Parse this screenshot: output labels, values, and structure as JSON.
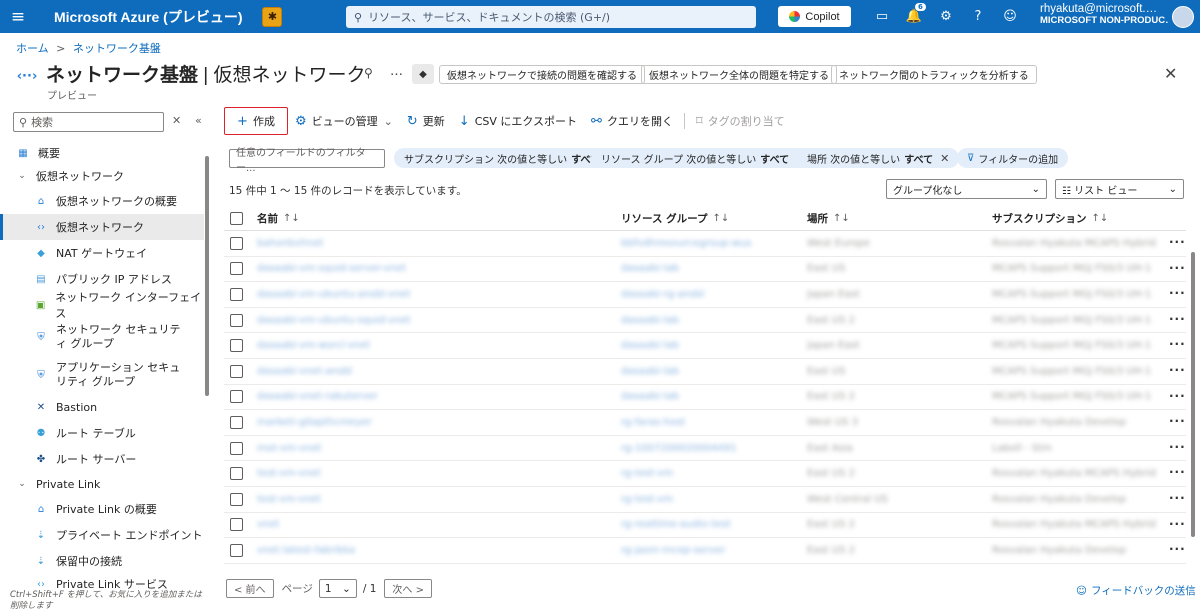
{
  "topbar": {
    "brand": "Microsoft Azure (プレビュー)",
    "search_placeholder": "リソース、サービス、ドキュメントの検索 (G+/)",
    "copilot_label": "Copilot",
    "notification_count": "6",
    "user_email": "rhyakuta@microsoft.…",
    "user_tenant": "MICROSOFT NON-PRODUC…",
    "colors": {
      "bar": "#0f6cbd"
    }
  },
  "breadcrumb": [
    "ホーム",
    ">",
    "ネットワーク基盤"
  ],
  "page": {
    "title_main": "ネットワーク基盤",
    "title_sep": "|",
    "title_sub": "仮想ネットワーク",
    "subtitle": "プレビュー",
    "more": "…",
    "header_buttons": [
      "仮想ネットワークで接続の問題を確認する",
      "仮想ネットワーク全体の問題を特定する",
      "ネットワーク間のトラフィックを分析する"
    ]
  },
  "sidebar": {
    "search_placeholder": "検索",
    "items": [
      {
        "label": "概要",
        "icon": "overview-icon",
        "level": 0
      },
      {
        "label": "仮想ネットワーク",
        "icon": "chevron-down-icon",
        "level": 0,
        "group": true
      },
      {
        "label": "仮想ネットワークの概要",
        "icon": "home-icon",
        "level": 1
      },
      {
        "label": "仮想ネットワーク",
        "icon": "vnet-icon",
        "level": 1,
        "selected": true
      },
      {
        "label": "NAT ゲートウェイ",
        "icon": "nat-gateway-icon",
        "level": 1
      },
      {
        "label": "パブリック IP アドレス",
        "icon": "public-ip-icon",
        "level": 1
      },
      {
        "label": "ネットワーク インターフェイス",
        "icon": "nic-icon",
        "level": 1
      },
      {
        "label": "ネットワーク セキュリティ グループ",
        "icon": "nsg-icon",
        "level": 1,
        "multiline": true
      },
      {
        "label": "アプリケーション セキュリティ グループ",
        "icon": "asg-icon",
        "level": 1,
        "multiline": true
      },
      {
        "label": "Bastion",
        "icon": "bastion-icon",
        "level": 1
      },
      {
        "label": "ルート テーブル",
        "icon": "route-table-icon",
        "level": 1
      },
      {
        "label": "ルート サーバー",
        "icon": "route-server-icon",
        "level": 1
      },
      {
        "label": "Private Link",
        "icon": "chevron-down-icon",
        "level": 0,
        "group": true
      },
      {
        "label": "Private Link の概要",
        "icon": "private-link-icon",
        "level": 1
      },
      {
        "label": "プライベート エンドポイント",
        "icon": "private-endpoint-icon",
        "level": 1
      },
      {
        "label": "保留中の接続",
        "icon": "pending-connection-icon",
        "level": 1
      },
      {
        "label": "Private Link サービス",
        "icon": "private-link-service-icon",
        "level": 1
      }
    ],
    "footer": "Ctrl+Shift+F を押して、お気に入りを追加または削除します"
  },
  "toolbar": {
    "create": "作成",
    "manage_view": "ビューの管理",
    "refresh": "更新",
    "export_csv": "CSV にエクスポート",
    "open_query": "クエリを開く",
    "assign_tags": "タグの割り当て"
  },
  "filters": {
    "placeholder": "任意のフィールドのフィルター...",
    "pills": [
      {
        "text": "サブスクリプション 次の値と等しい",
        "value": "すべて",
        "removable": false
      },
      {
        "text": "リソース グループ 次の値と等しい",
        "value": "すべて",
        "removable": true
      },
      {
        "text": "場所 次の値と等しい",
        "value": "すべて",
        "removable": true
      }
    ],
    "add_filter": "フィルターの追加"
  },
  "records_text": "15 件中 1 ～ 15 件のレコードを表示しています。",
  "grouping": "グループ化なし",
  "view_mode": "リスト ビュー",
  "table": {
    "columns": [
      "名前",
      "リソース グループ",
      "場所",
      "サブスクリプション"
    ],
    "rows": [
      [
        "bahonbvhnet",
        "bbfvdhresourcegroup-wus",
        "West Europe",
        "Rosvalan Hyakuta MCAPS Hybrid"
      ],
      [
        "dasaabi-vm-squid-server-vnet",
        "dasaabi-lab",
        "East US",
        "MCAPS Support MGJ FS0/3 UH-1"
      ],
      [
        "dasaabi-vm-ubuntu-ansbl-vnet",
        "dasaabi-rg-ansbl",
        "Japan East",
        "MCAPS Support MGJ FS0/3 UH-1"
      ],
      [
        "dasaabi-vm-ubuntu-squid-vnet",
        "dasaabi-lab",
        "East US 2",
        "MCAPS Support MGJ FS0/3 UH-1"
      ],
      [
        "dasaabi-vm-wsrcl-vnet",
        "dasaabi-lab",
        "Japan East",
        "MCAPS Support MGJ FS0/3 UH-1"
      ],
      [
        "dasaabi-vnet-ansbl",
        "dasaabi-lab",
        "East US",
        "MCAPS Support MGJ FS0/3 UH-1"
      ],
      [
        "dasaabi-vnet-rakuterver",
        "dasaabi-lab",
        "East US 2",
        "MCAPS Support MGJ FS0/3 UH-1"
      ],
      [
        "marketi-g0apthcmeyer",
        "rg-faras-host",
        "West US 3",
        "Rosvalan Hyakuta Develop"
      ],
      [
        "mot-vm-vnet",
        "rg-1007200020004491",
        "East Asia",
        "Laboll - Stm"
      ],
      [
        "test-vm-vnet",
        "rg-test-vm",
        "East US 2",
        "Rosvalan Hyakuta MCAPS Hybrid"
      ],
      [
        "test-vm-vnet",
        "rg-test-vm",
        "West Central US",
        "Rosvalan Hyakuta Develop"
      ],
      [
        "vnet",
        "rg-realtime-audio-test",
        "East US 2",
        "Rosvalan Hyakuta MCAPS Hybrid"
      ],
      [
        "vnet-latest-fabrikka",
        "rg-jasm-mcep-server",
        "East US 2",
        "Rosvalan Hyakuta Develop"
      ]
    ]
  },
  "pager": {
    "prev": "< 前へ",
    "page_label": "ページ",
    "page_value": "1",
    "total": "/ 1",
    "next": "次へ >"
  },
  "feedback": "フィードバックの送信"
}
